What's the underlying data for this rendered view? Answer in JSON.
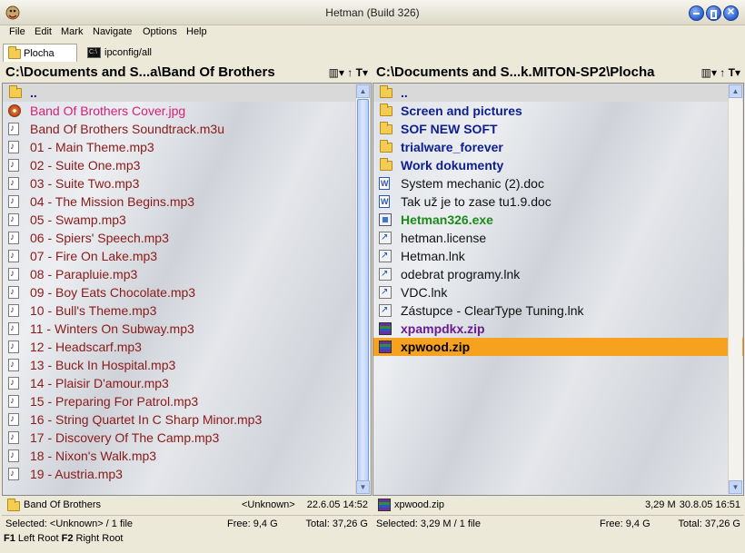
{
  "window": {
    "title": "Hetman (Build 326)"
  },
  "menu": [
    "File",
    "Edit",
    "Mark",
    "Navigate",
    "Options",
    "Help"
  ],
  "tabs": [
    {
      "label": "Plocha",
      "icon": "folder-icon"
    },
    {
      "label": "ipconfig/all",
      "icon": "command-prompt-icon"
    }
  ],
  "left": {
    "path": "C:\\Documents and S...a\\Band Of Brothers",
    "tools": "▥▾ ↑ T▾",
    "files": [
      {
        "name": "..",
        "type": "up"
      },
      {
        "name": "Band Of Brothers Cover.jpg",
        "type": "jpg"
      },
      {
        "name": "Band Of Brothers Soundtrack.m3u",
        "type": "music"
      },
      {
        "name": "01 - Main Theme.mp3",
        "type": "music"
      },
      {
        "name": "02 - Suite One.mp3",
        "type": "music"
      },
      {
        "name": "03 - Suite Two.mp3",
        "type": "music"
      },
      {
        "name": "04 - The Mission Begins.mp3",
        "type": "music"
      },
      {
        "name": "05 - Swamp.mp3",
        "type": "music"
      },
      {
        "name": "06 - Spiers' Speech.mp3",
        "type": "music"
      },
      {
        "name": "07 - Fire On Lake.mp3",
        "type": "music"
      },
      {
        "name": "08 - Parapluie.mp3",
        "type": "music"
      },
      {
        "name": "09 - Boy Eats Chocolate.mp3",
        "type": "music"
      },
      {
        "name": "10 - Bull's Theme.mp3",
        "type": "music"
      },
      {
        "name": "11 - Winters On Subway.mp3",
        "type": "music"
      },
      {
        "name": "12 - Headscarf.mp3",
        "type": "music"
      },
      {
        "name": "13 - Buck In Hospital.mp3",
        "type": "music"
      },
      {
        "name": "14 - Plaisir D'amour.mp3",
        "type": "music"
      },
      {
        "name": "15 - Preparing For Patrol.mp3",
        "type": "music"
      },
      {
        "name": "16 - String Quartet In C Sharp Minor.mp3",
        "type": "music"
      },
      {
        "name": "17 - Discovery Of The Camp.mp3",
        "type": "music"
      },
      {
        "name": "18 - Nixon's Walk.mp3",
        "type": "music"
      },
      {
        "name": "19 - Austria.mp3",
        "type": "music"
      }
    ],
    "info": {
      "name": "Band Of Brothers",
      "size": "<Unknown>",
      "date": "22.6.05 14:52"
    },
    "status": {
      "selected": "Selected: <Unknown> / 1 file",
      "free": "Free: 9,4 G",
      "total": "Total: 37,26 G"
    }
  },
  "right": {
    "path": "C:\\Documents and S...k.MITON-SP2\\Plocha",
    "tools": "▥▾ ↑ T▾",
    "files": [
      {
        "name": "..",
        "type": "up"
      },
      {
        "name": "Screen and pictures",
        "type": "folder"
      },
      {
        "name": "SOF NEW SOFT",
        "type": "folder"
      },
      {
        "name": "trialware_forever",
        "type": "folder"
      },
      {
        "name": "Work dokumenty",
        "type": "folder"
      },
      {
        "name": "System mechanic (2).doc",
        "type": "doc"
      },
      {
        "name": "Tak už je to zase tu1.9.doc",
        "type": "doc"
      },
      {
        "name": "Hetman326.exe",
        "type": "exe"
      },
      {
        "name": "hetman.license",
        "type": "plain"
      },
      {
        "name": "Hetman.lnk",
        "type": "lnk"
      },
      {
        "name": "odebrat programy.lnk",
        "type": "lnk"
      },
      {
        "name": "VDC.lnk",
        "type": "lnk"
      },
      {
        "name": "Zástupce - ClearType Tuning.lnk",
        "type": "lnk"
      },
      {
        "name": "xpampdkx.zip",
        "type": "zip"
      },
      {
        "name": "xpwood.zip",
        "type": "zip",
        "selected": true
      }
    ],
    "info": {
      "name": "xpwood.zip",
      "size": "3,29 M",
      "date": "30.8.05 16:51"
    },
    "status": {
      "selected": "Selected: 3,29 M / 1 file",
      "free": "Free: 9,4 G",
      "total": "Total: 37,26 G"
    }
  },
  "keybar": [
    {
      "key": "F1",
      "label": "Left Root"
    },
    {
      "key": "F2",
      "label": "Right Root"
    }
  ]
}
